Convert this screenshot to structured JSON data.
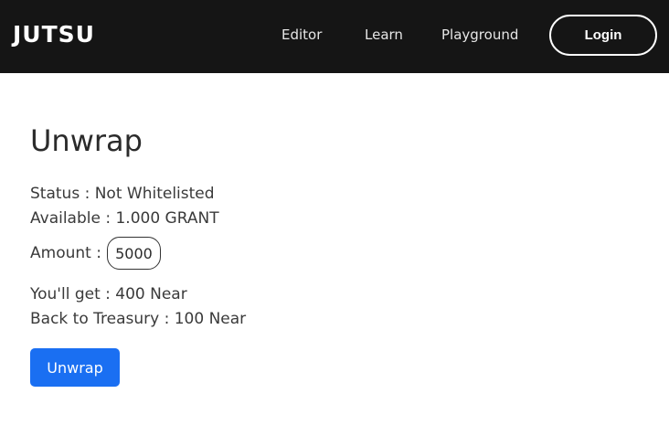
{
  "header": {
    "logo_text": "JUTSU",
    "nav": {
      "editor": "Editor",
      "learn": "Learn",
      "playground": "Playground"
    },
    "login_label": "Login"
  },
  "main": {
    "title": "Unwrap",
    "status": "Status : Not Whitelisted",
    "available": "Available : 1.000 GRANT",
    "amount_label": "Amount :",
    "amount_value": "5000",
    "you_get": "You'll get : 400 Near",
    "back_to_treasury": "Back to Treasury : 100 Near",
    "unwrap_button": "Unwrap"
  },
  "colors": {
    "navbar_bg": "#151515",
    "accent": "#1a6ff2"
  }
}
